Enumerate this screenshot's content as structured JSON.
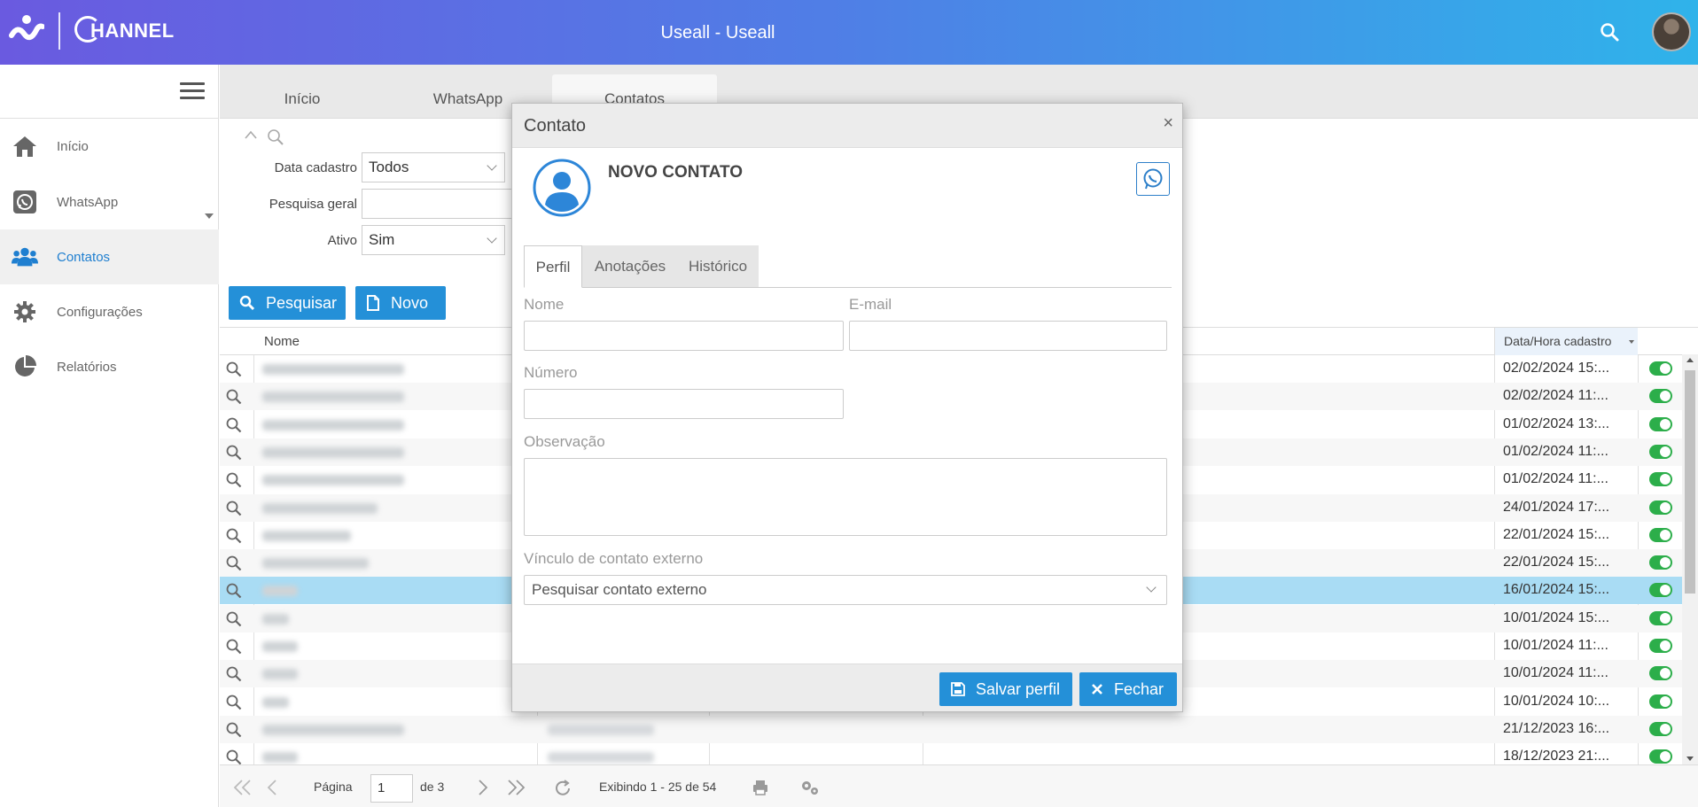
{
  "header": {
    "brand_text": "HANNEL",
    "title": "Useall - Useall"
  },
  "sidebar": {
    "items": [
      {
        "label": "Início",
        "icon": "home-icon"
      },
      {
        "label": "WhatsApp",
        "icon": "whatsapp-icon"
      },
      {
        "label": "Contatos",
        "icon": "users-icon",
        "active": true
      },
      {
        "label": "Configurações",
        "icon": "gear-icon"
      },
      {
        "label": "Relatórios",
        "icon": "pie-chart-icon"
      }
    ]
  },
  "tabs": [
    {
      "label": "Início"
    },
    {
      "label": "WhatsApp"
    },
    {
      "label": "Contatos",
      "active": true
    }
  ],
  "filters": {
    "data_cadastro_label": "Data cadastro",
    "data_cadastro_value": "Todos",
    "pesquisa_geral_label": "Pesquisa geral",
    "pesquisa_geral_value": "",
    "ativo_label": "Ativo",
    "ativo_value": "Sim",
    "search_button": "Pesquisar",
    "new_button": "Novo"
  },
  "grid": {
    "col_nome": "Nome",
    "col_data": "Data/Hora cadastro",
    "rows": [
      {
        "date": "02/02/2024 15:...",
        "active": true
      },
      {
        "date": "02/02/2024 11:...",
        "active": true
      },
      {
        "date": "01/02/2024 13:...",
        "active": true
      },
      {
        "date": "01/02/2024 11:...",
        "active": true
      },
      {
        "date": "01/02/2024 11:...",
        "active": true
      },
      {
        "date": "24/01/2024 17:...",
        "active": true
      },
      {
        "date": "22/01/2024 15:...",
        "active": true
      },
      {
        "date": "22/01/2024 15:...",
        "active": true
      },
      {
        "date": "16/01/2024 15:...",
        "active": true,
        "selected": true
      },
      {
        "date": "10/01/2024 15:...",
        "active": true
      },
      {
        "date": "10/01/2024 11:...",
        "active": true
      },
      {
        "date": "10/01/2024 11:...",
        "active": true
      },
      {
        "date": "10/01/2024 10:...",
        "active": true
      },
      {
        "date": "21/12/2023 16:...",
        "active": true
      },
      {
        "date": "18/12/2023 21:...",
        "active": true
      }
    ]
  },
  "pager": {
    "page_label": "Página",
    "page_value": "1",
    "of_label": "de 3",
    "display_text": "Exibindo 1 - 25 de 54"
  },
  "modal": {
    "title": "Contato",
    "close": "×",
    "heading": "NOVO CONTATO",
    "tabs": [
      "Perfil",
      "Anotações",
      "Histórico"
    ],
    "nome_label": "Nome",
    "email_label": "E-mail",
    "numero_label": "Número",
    "observacao_label": "Observação",
    "vinculo_label": "Vínculo de contato externo",
    "vinculo_placeholder": "Pesquisar contato externo",
    "save_button": "Salvar perfil",
    "close_button": "Fechar"
  },
  "colors": {
    "accent": "#2490d8",
    "toggle_on": "#2cae4a",
    "selected_row": "#a9dcf4"
  }
}
